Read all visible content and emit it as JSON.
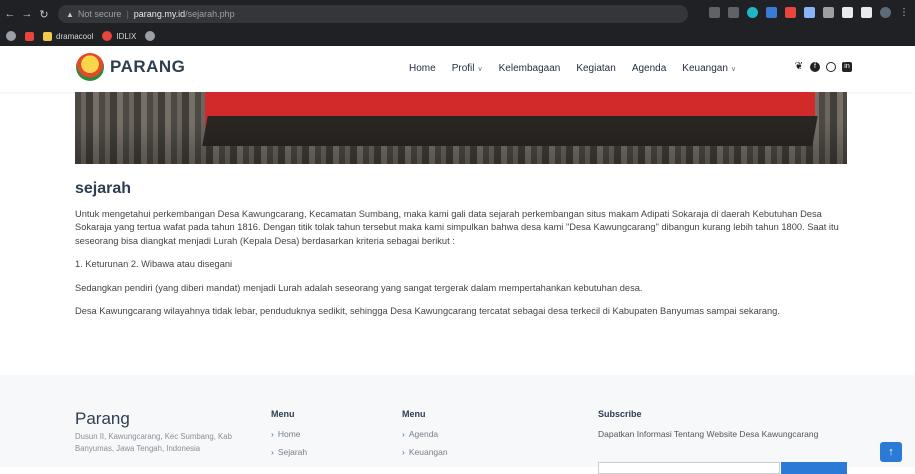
{
  "browser": {
    "security_label": "Not secure",
    "host": "parang.my.id",
    "path": "/sejarah.php",
    "bookmarks": [
      "dramacool",
      "IDLIX"
    ]
  },
  "header": {
    "brand": "PARANG",
    "nav": [
      {
        "label": "Home"
      },
      {
        "label": "Profil"
      },
      {
        "label": "Kelembagaan"
      },
      {
        "label": "Kegiatan"
      },
      {
        "label": "Agenda"
      },
      {
        "label": "Keuangan"
      }
    ]
  },
  "article": {
    "title": "sejarah",
    "paragraphs": [
      "Untuk mengetahui perkembangan Desa Kawungcarang, Kecamatan Sumbang, maka kami gali data sejarah perkembangan situs makam Adipati Sokaraja di daerah Kebutuhan Desa Sokaraja yang tertua wafat pada tahun 1816. Dengan titik tolak tahun tersebut maka kami simpulkan bahwa desa kami \"Desa Kawungcarang\" dibangun kurang lebih tahun 1800. Saat itu seseorang bisa diangkat menjadi Lurah (Kepala Desa) berdasarkan kriteria sebagai berikut :",
      "1. Keturunan 2. Wibawa atau disegani",
      "Sedangkan pendiri (yang diberi mandat) menjadi Lurah adalah seseorang yang sangat tergerak dalam mempertahankan kebutuhan desa.",
      "Desa Kawungcarang wilayahnya tidak lebar, penduduknya sedikit, sehingga Desa Kawungcarang tercatat sebagai desa terkecil di Kabupaten Banyumas sampai sekarang."
    ]
  },
  "footer": {
    "brand": "Parang",
    "address": "Dusun II, Kawungcarang, Kec Sumbang, Kab Banyumas, Jawa Tengah, Indonesia",
    "menu1": {
      "title": "Menu",
      "links": [
        "Home",
        "Sejarah"
      ]
    },
    "menu2": {
      "title": "Menu",
      "links": [
        "Agenda",
        "Keuangan"
      ]
    },
    "subscribe": {
      "title": "Subscribe",
      "text": "Dapatkan Informasi Tentang Website Desa Kawungcarang"
    }
  }
}
